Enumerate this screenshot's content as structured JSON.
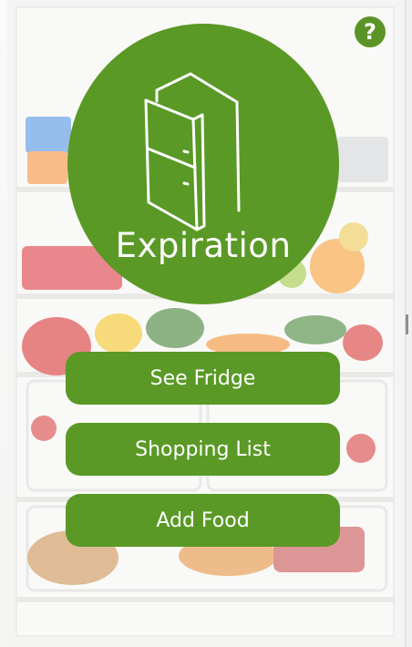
{
  "app": {
    "logo_text": "Expiration",
    "help_symbol": "?",
    "help_icon": "question-circle-icon",
    "logo_icon": "fridge-icon"
  },
  "menu": {
    "items": [
      {
        "label": "See Fridge"
      },
      {
        "label": "Shopping List"
      },
      {
        "label": "Add Food"
      }
    ]
  },
  "colors": {
    "brand_green": "#5a9926",
    "button_text": "#ffffff",
    "background": "#f4f5f5"
  }
}
